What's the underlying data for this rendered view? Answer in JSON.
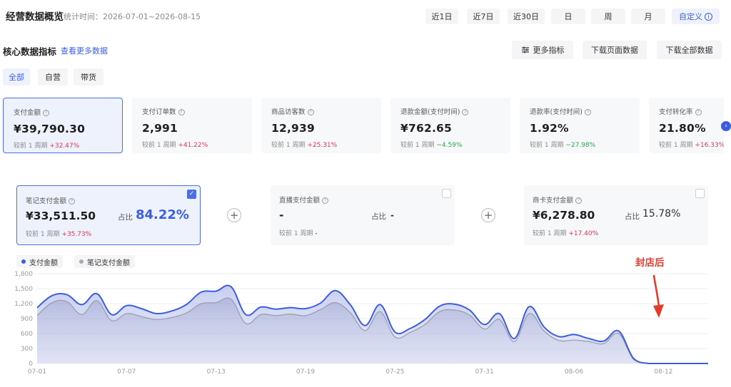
{
  "header": {
    "title": "经营数据概览",
    "stat_time": "统计时间：2026-07-01~2026-08-15",
    "ranges": [
      "近1日",
      "近7日",
      "近30日",
      "日",
      "周",
      "月"
    ],
    "custom_label": "自定义"
  },
  "core": {
    "title": "核心数据指标",
    "see_more": "查看更多数据",
    "more_metrics": "更多指标",
    "download_page": "下载页面数据",
    "download_all": "下载全部数据"
  },
  "filters": [
    "全部",
    "自营",
    "带货"
  ],
  "metrics": [
    {
      "label": "支付金额",
      "value": "¥39,790.30",
      "cmp": "较前 1 周期",
      "delta": "+32.47%"
    },
    {
      "label": "支付订单数",
      "value": "2,991",
      "cmp": "较前 1 周期",
      "delta": "+41.22%"
    },
    {
      "label": "商品访客数",
      "value": "12,939",
      "cmp": "较前 1 周期",
      "delta": "+25.31%"
    },
    {
      "label": "退款金额(支付时间)",
      "value": "¥762.65",
      "cmp": "较前 1 周期",
      "delta": "−4.59%"
    },
    {
      "label": "退款率(支付时间)",
      "value": "1.92%",
      "cmp": "较前 1 周期",
      "delta": "−27.98%"
    },
    {
      "label": "支付转化率",
      "value": "21.80%",
      "cmp": "较前 1 周期",
      "delta": "+16.33%"
    }
  ],
  "channels": [
    {
      "label": "笔记支付金额",
      "value": "¥33,511.50",
      "share_label": "占比",
      "share": "84.22%",
      "cmp": "较前 1 周期",
      "delta": "+35.73%"
    },
    {
      "label": "直播支付金额",
      "value": "-",
      "share_label": "占比",
      "share": "-",
      "cmp": "较前 1 周期",
      "delta": "-"
    },
    {
      "label": "商卡支付金额",
      "value": "¥6,278.80",
      "share_label": "占比",
      "share": "15.78%",
      "cmp": "较前 1 周期",
      "delta": "+17.40%"
    }
  ],
  "colors": {
    "accent": "#3b5ee0",
    "up": "#e0355a",
    "down": "#2ba84a",
    "annotation": "#e53b2c"
  },
  "annotation": "封店后",
  "chart_data": {
    "type": "area",
    "legend": [
      "支付金额",
      "笔记支付金额"
    ],
    "y_ticks": [
      "0",
      "300",
      "600",
      "900",
      "1,200",
      "1,500",
      "1,800"
    ],
    "ylim": [
      0,
      1800
    ],
    "x_ticks": [
      "07-01",
      "07-07",
      "07-13",
      "07-19",
      "07-25",
      "07-31",
      "08-06",
      "08-12"
    ],
    "x": [
      "07-01",
      "07-02",
      "07-03",
      "07-04",
      "07-05",
      "07-06",
      "07-07",
      "07-08",
      "07-09",
      "07-10",
      "07-11",
      "07-12",
      "07-13",
      "07-14",
      "07-15",
      "07-16",
      "07-17",
      "07-18",
      "07-19",
      "07-20",
      "07-21",
      "07-22",
      "07-23",
      "07-24",
      "07-25",
      "07-26",
      "07-27",
      "07-28",
      "07-29",
      "07-30",
      "07-31",
      "08-01",
      "08-02",
      "08-03",
      "08-04",
      "08-05",
      "08-06",
      "08-07",
      "08-08",
      "08-09",
      "08-10",
      "08-11",
      "08-12",
      "08-13",
      "08-14",
      "08-15"
    ],
    "series": [
      {
        "name": "支付金额",
        "values": [
          1120,
          1360,
          1380,
          1180,
          1400,
          980,
          1160,
          1100,
          1000,
          1050,
          1180,
          1430,
          1450,
          1540,
          980,
          1130,
          1090,
          1120,
          1100,
          1210,
          1460,
          1180,
          760,
          1180,
          630,
          700,
          880,
          1150,
          1190,
          1070,
          780,
          1000,
          500,
          1140,
          730,
          540,
          580,
          500,
          450,
          650,
          100,
          0,
          0,
          0,
          0,
          0
        ]
      },
      {
        "name": "笔记支付金额",
        "values": [
          960,
          1220,
          1240,
          980,
          1260,
          860,
          1000,
          940,
          880,
          920,
          1010,
          1200,
          1220,
          1290,
          800,
          980,
          960,
          990,
          960,
          1080,
          1220,
          1020,
          660,
          1040,
          530,
          620,
          780,
          1040,
          1070,
          970,
          690,
          880,
          440,
          1000,
          650,
          460,
          470,
          440,
          400,
          600,
          80,
          0,
          0,
          0,
          0,
          0
        ]
      }
    ]
  }
}
